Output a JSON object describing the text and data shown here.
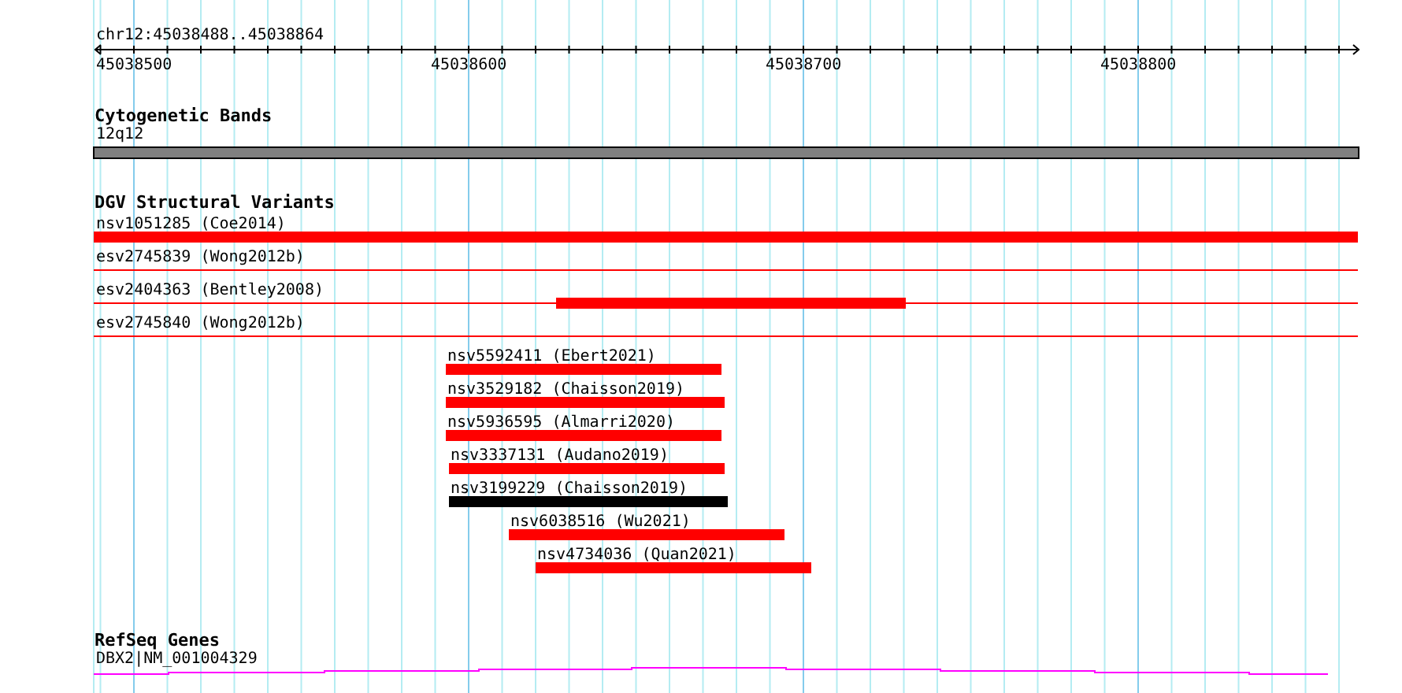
{
  "ruler": {
    "location": "chr12:45038488..45038864",
    "ticks": [
      "45038500",
      "45038600",
      "45038700",
      "45038800"
    ]
  },
  "tracks": [
    {
      "title": "Cytogenetic Bands",
      "kind": "bands",
      "features": [
        {
          "label": "12q12",
          "color": "#808080"
        }
      ]
    },
    {
      "title": "DGV Structural Variants",
      "kind": "variants",
      "features": [
        {
          "label": "nsv1051285 (Coe2014)",
          "color": "#ff0000",
          "kind": "bar"
        },
        {
          "label": "esv2745839 (Wong2012b)",
          "color": "#ff0000",
          "kind": "line"
        },
        {
          "label": "esv2404363 (Bentley2008)",
          "color": "#ff0000",
          "kind": "line-bar"
        },
        {
          "label": "esv2745840 (Wong2012b)",
          "color": "#ff0000",
          "kind": "line"
        },
        {
          "label": "nsv5592411 (Ebert2021)",
          "color": "#ff0000",
          "kind": "bar"
        },
        {
          "label": "nsv3529182 (Chaisson2019)",
          "color": "#ff0000",
          "kind": "bar"
        },
        {
          "label": "nsv5936595 (Almarri2020)",
          "color": "#ff0000",
          "kind": "bar"
        },
        {
          "label": "nsv3337131 (Audano2019)",
          "color": "#ff0000",
          "kind": "bar"
        },
        {
          "label": "nsv3199229 (Chaisson2019)",
          "color": "#000000",
          "kind": "bar"
        },
        {
          "label": "nsv6038516 (Wu2021)",
          "color": "#ff0000",
          "kind": "bar"
        },
        {
          "label": "nsv4734036 (Quan2021)",
          "color": "#ff0000",
          "kind": "bar"
        }
      ]
    },
    {
      "title": "RefSeq Genes",
      "kind": "genes",
      "features": [
        {
          "label": "DBX2|NM_001004329",
          "color": "#ff00ff"
        }
      ]
    }
  ]
}
